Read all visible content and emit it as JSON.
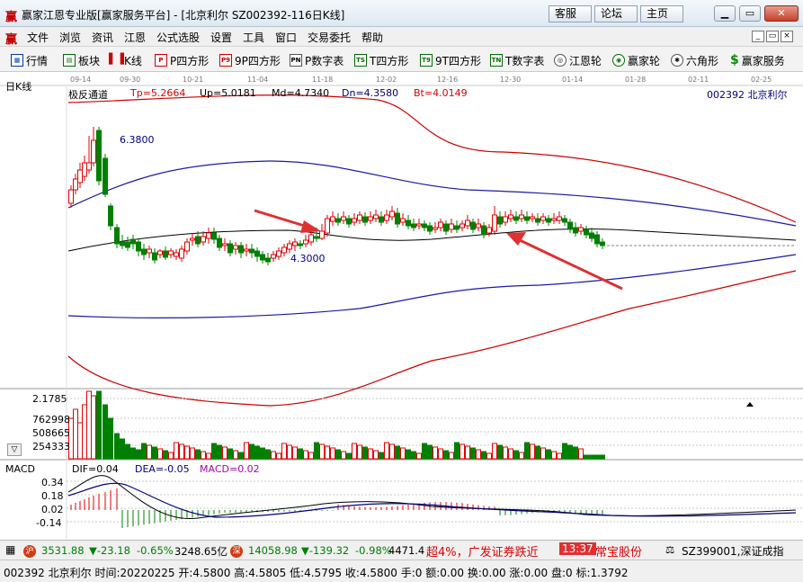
{
  "window": {
    "logo_glyph": "赢",
    "title": "赢家江恩专业版[赢家服务平台] - [北京利尔  SZ002392-116日K线]",
    "top_buttons": [
      "客服",
      "论坛",
      "主页"
    ],
    "controls": {
      "minimize": "▁",
      "restore": "▭",
      "close": "✕"
    }
  },
  "menubar": {
    "logo_glyph": "赢",
    "items": [
      "文件",
      "浏览",
      "资讯",
      "江恩",
      "公式选股",
      "设置",
      "工具",
      "窗口",
      "交易委托",
      "帮助"
    ],
    "mdi_controls": [
      "_",
      "▭",
      "×"
    ]
  },
  "toolbar": {
    "items": [
      {
        "label": "行情",
        "icon": "grid-icon"
      },
      {
        "label": "板块",
        "icon": "blocks-icon"
      },
      {
        "label": "K线",
        "icon": "candles-icon"
      },
      {
        "label": "P四方形",
        "icon": "P"
      },
      {
        "label": "9P四方形",
        "icon": "P9"
      },
      {
        "label": "P数字表",
        "icon": "PN"
      },
      {
        "label": "T四方形",
        "icon": "TS"
      },
      {
        "label": "9T四方形",
        "icon": "T9"
      },
      {
        "label": "T数字表",
        "icon": "TN"
      },
      {
        "label": "江恩轮",
        "icon": "wheel-icon"
      },
      {
        "label": "赢家轮",
        "icon": "wheel2-icon"
      },
      {
        "label": "六角形",
        "icon": "hexagon-icon"
      },
      {
        "label": "赢家服务",
        "icon": "dollar-icon"
      }
    ]
  },
  "chart": {
    "period_label": "日K线",
    "date_ticks": [
      "09-14",
      "09-30",
      "10-21",
      "11-04",
      "11-18",
      "12-02",
      "12-16",
      "12-30",
      "01-14",
      "01-28",
      "02-11",
      "02-25"
    ],
    "indicator_name": "极反通道",
    "indicator_values": [
      {
        "label": "Tp=5.2664",
        "color": "#e00000"
      },
      {
        "label": "Up=5.0181",
        "color": "#000000"
      },
      {
        "label": "Md=4.7340",
        "color": "#000000"
      },
      {
        "label": "Dn=4.3580",
        "color": "#000080"
      },
      {
        "label": "Bt=4.0149",
        "color": "#e00000"
      }
    ],
    "stock_label": "002392 北京利尔",
    "high_mark": "6.3800",
    "low_mark": "4.3000",
    "colors": {
      "up": "#e00000",
      "down": "#008000",
      "mid": "#000000",
      "inner": "#1a1aa8",
      "outer": "#d00000",
      "arrow": "#e03030"
    }
  },
  "volume": {
    "y_ticks": [
      "2.1785",
      "762998",
      "508665",
      "254333"
    ],
    "collapse_glyph": "▽"
  },
  "macd": {
    "name": "MACD",
    "dif": "DIF=0.04",
    "dea": "DEA=-0.05",
    "macd": "MACD=0.02",
    "y_ticks": [
      "0.34",
      "0.18",
      "0.02",
      "-0.14"
    ]
  },
  "index_bar": {
    "sh_badge": "沪",
    "sh_value": "3531.88",
    "sh_change": "▼-23.18",
    "sh_pct": "-0.65%",
    "sh_amount": "3248.65亿",
    "sz_badge": "深",
    "sz_value": "14058.98",
    "sz_change": "▼-139.32",
    "sz_pct": "-0.98%",
    "sz_amount": "4471.4",
    "news": "超4%，广发证券跌近",
    "time": "13:37",
    "news_stock": "常宝股份",
    "right_code": "SZ399001,深证成指"
  },
  "info_bar": {
    "text": "002392 北京利尔 时间:20220225 开:4.5800 高:4.5805 低:4.5795 收:4.5800 手:0 额:0.00 换:0.00 涨:0.00 盘:0 标:1.3792"
  }
}
